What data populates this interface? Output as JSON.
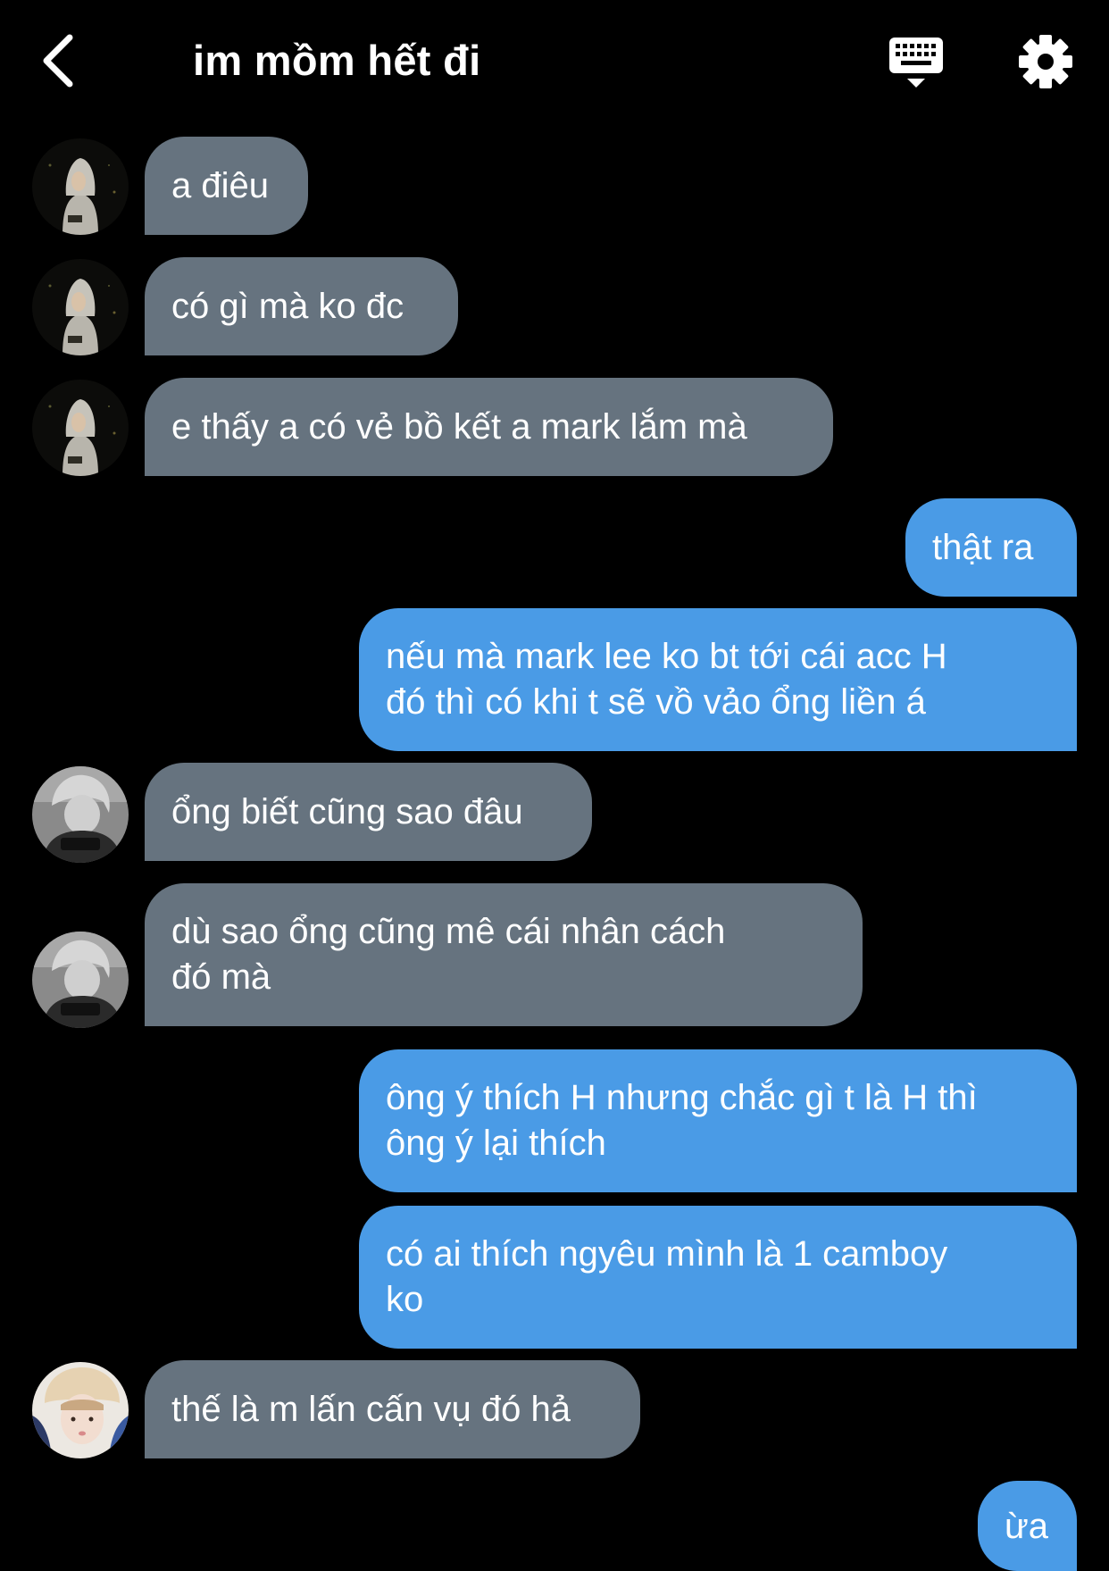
{
  "header": {
    "title": "im mồm hết đi",
    "back_icon": "chevron-left-icon",
    "keyboard_icon": "keyboard-icon",
    "settings_icon": "gear-icon"
  },
  "colors": {
    "background": "#000000",
    "incoming_bubble": "#66737f",
    "outgoing_bubble": "#4a9be6",
    "text": "#ffffff"
  },
  "messages": [
    {
      "direction": "incoming",
      "lines": [
        "a điêu"
      ]
    },
    {
      "direction": "incoming",
      "lines": [
        "có gì mà ko đc"
      ]
    },
    {
      "direction": "incoming",
      "lines": [
        "e thấy a có vẻ bồ kết a mark lắm mà"
      ]
    },
    {
      "direction": "outgoing",
      "lines": [
        "thật ra"
      ]
    },
    {
      "direction": "outgoing",
      "lines": [
        "nếu mà mark lee ko bt tới cái acc H",
        "đó thì có khi t sẽ vồ vảo ổng liền á"
      ]
    },
    {
      "direction": "incoming",
      "lines": [
        "ổng biết cũng sao đâu"
      ]
    },
    {
      "direction": "incoming",
      "lines": [
        "dù sao ổng cũng mê cái nhân cách",
        "đó mà"
      ]
    },
    {
      "direction": "outgoing",
      "lines": [
        "ông ý thích H nhưng chắc gì t là H thì",
        "ông ý lại thích"
      ]
    },
    {
      "direction": "outgoing",
      "lines": [
        "có ai thích ngyêu mình là 1 camboy",
        "ko"
      ]
    },
    {
      "direction": "incoming",
      "lines": [
        "thế là m lấn cấn vụ đó hả"
      ]
    },
    {
      "direction": "outgoing",
      "lines": [
        "ừa"
      ]
    }
  ]
}
